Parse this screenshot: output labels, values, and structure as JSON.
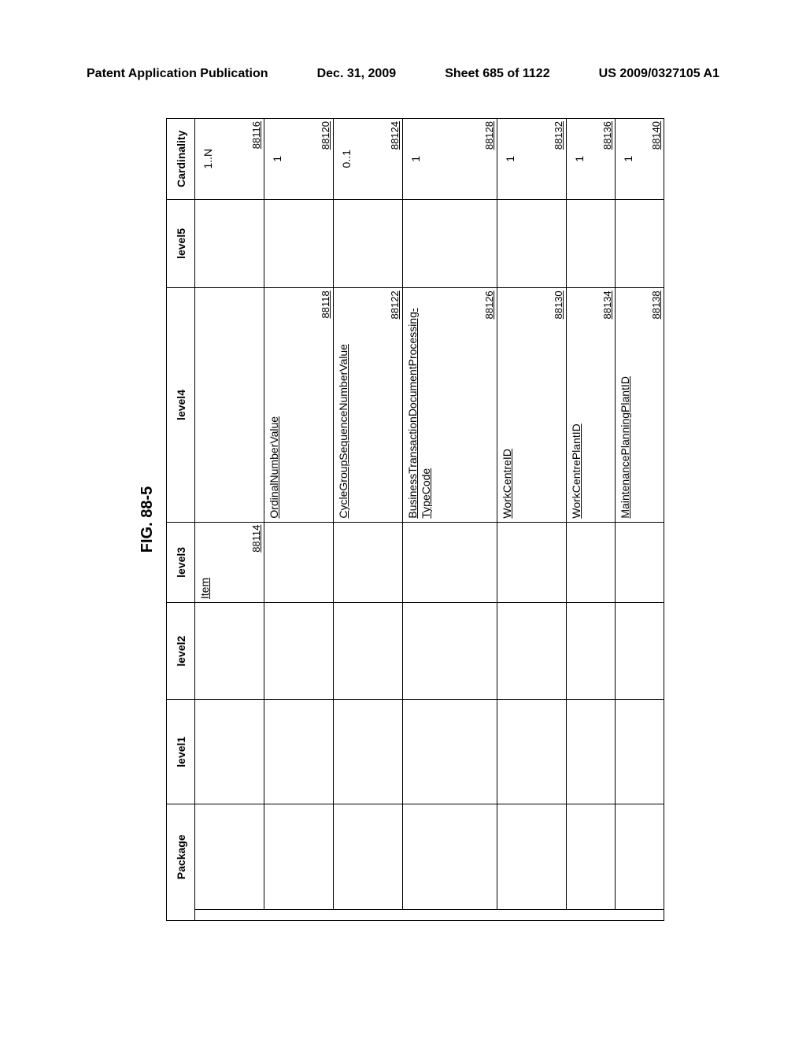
{
  "header": {
    "left": "Patent Application Publication",
    "mid": "Dec. 31, 2009",
    "sheet": "Sheet 685 of 1122",
    "right": "US 2009/0327105 A1"
  },
  "figure_title": "FIG. 88-5",
  "columns": {
    "package": "Package",
    "level1": "level1",
    "level2": "level2",
    "level3": "level3",
    "level4": "level4",
    "level5": "level5",
    "cardinality": "Cardinality"
  },
  "rows": [
    {
      "level3": "Item",
      "level3_ref": "88114",
      "level4": "",
      "level4_ref": "",
      "card": "1..N",
      "card_ref": "88116",
      "cls": ""
    },
    {
      "level3": "",
      "level3_ref": "",
      "level4": "OrdinalNumberValue",
      "level4_ref": "88118",
      "card": "1",
      "card_ref": "88120",
      "cls": ""
    },
    {
      "level3": "",
      "level3_ref": "",
      "level4": "CycleGroupSequenceNumberValue",
      "level4_ref": "88122",
      "card": "0..1",
      "card_ref": "88124",
      "cls": ""
    },
    {
      "level3": "",
      "level3_ref": "",
      "level4": "BusinessTransactionDocumentProcessing-TypeCode",
      "level4_ref": "88126",
      "card": "1",
      "card_ref": "88128",
      "cls": "tall"
    },
    {
      "level3": "",
      "level3_ref": "",
      "level4": "WorkCentreID",
      "level4_ref": "88130",
      "card": "1",
      "card_ref": "88132",
      "cls": ""
    },
    {
      "level3": "",
      "level3_ref": "",
      "level4": "WorkCentrePlantID",
      "level4_ref": "88134",
      "card": "1",
      "card_ref": "88136",
      "cls": "short"
    },
    {
      "level3": "",
      "level3_ref": "",
      "level4": "MaintenancePlanningPlantID",
      "level4_ref": "88138",
      "card": "1",
      "card_ref": "88140",
      "cls": "short"
    }
  ]
}
